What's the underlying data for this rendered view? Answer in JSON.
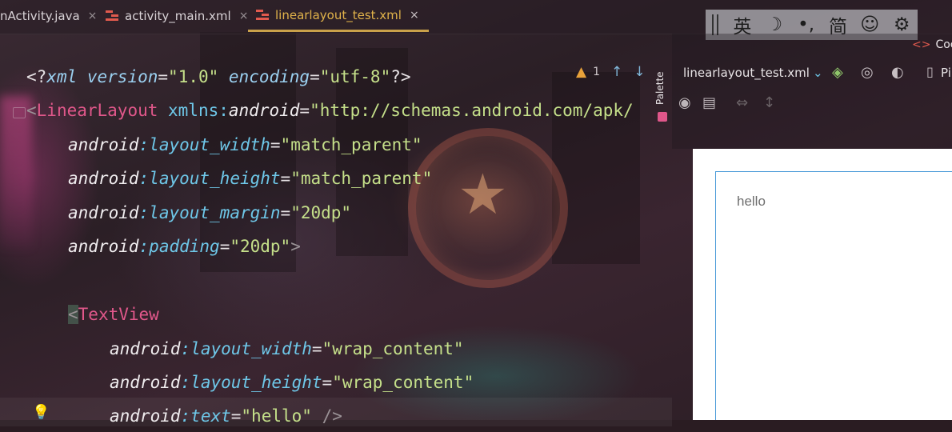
{
  "tabs": [
    {
      "label": "nActivity.java",
      "active": false,
      "type": "java"
    },
    {
      "label": "activity_main.xml",
      "active": false,
      "type": "xml"
    },
    {
      "label": "linearlayout_test.xml",
      "active": true,
      "type": "xml"
    }
  ],
  "tab_close_glyph": "×",
  "ime": {
    "items": [
      "英",
      "☽",
      "•,",
      "简",
      "☺",
      "⚙"
    ],
    "icon_names": [
      "english-mode-icon",
      "moon-icon",
      "punctuation-icon",
      "simplified-chinese-icon",
      "emoji-icon",
      "settings-gear-icon"
    ]
  },
  "code": {
    "xml_decl": {
      "open": "<?",
      "name": "xml",
      "attr1": " version",
      "eq1": "=",
      "val1": "\"1.0\"",
      "attr2": " encoding",
      "eq2": "=",
      "val2": "\"utf-8\"",
      "close": "?>"
    },
    "linearlayout_open": {
      "lt": "<",
      "tag": "LinearLayout",
      "ns": " xmlns:",
      "attr": "android",
      "eq": "=",
      "val": "\"http://schemas.android.com/apk/"
    },
    "ll_attrs": [
      {
        "prefix": "android",
        "colon": ":",
        "name": "layout_width",
        "eq": "=",
        "val": "\"match_parent\"",
        "tail": ""
      },
      {
        "prefix": "android",
        "colon": ":",
        "name": "layout_height",
        "eq": "=",
        "val": "\"match_parent\"",
        "tail": ""
      },
      {
        "prefix": "android",
        "colon": ":",
        "name": "layout_margin",
        "eq": "=",
        "val": "\"20dp\"",
        "tail": ""
      },
      {
        "prefix": "android",
        "colon": ":",
        "name": "padding",
        "eq": "=",
        "val": "\"20dp\"",
        "tail": ">"
      }
    ],
    "textview_open": {
      "lt": "<",
      "tag": "TextView"
    },
    "tv_attrs": [
      {
        "prefix": "android",
        "colon": ":",
        "name": "layout_width",
        "eq": "=",
        "val": "\"wrap_content\"",
        "tail": ""
      },
      {
        "prefix": "android",
        "colon": ":",
        "name": "layout_height",
        "eq": "=",
        "val": "\"wrap_content\"",
        "tail": ""
      },
      {
        "prefix": "android",
        "colon": ":",
        "name": "text",
        "eq": "=",
        "val": "\"hello\"",
        "tail": " />"
      }
    ]
  },
  "inspection": {
    "warning_count": "1",
    "up": "↑",
    "down": "↓",
    "warn_glyph": "▲"
  },
  "palette": {
    "label": "Palette"
  },
  "design": {
    "code_button": "Coc",
    "code_glyph": "<>",
    "file_dropdown": "linearlayout_test.xml",
    "dropdown_chevron": "⌄",
    "device_label": "Pi",
    "preview_text": "hello"
  },
  "colors": {
    "accent_tab": "#c9a14a",
    "tag": "#e0578a",
    "string": "#c5e08a",
    "namespace": "#6ec7e8",
    "device_border": "#4a9ad8"
  }
}
